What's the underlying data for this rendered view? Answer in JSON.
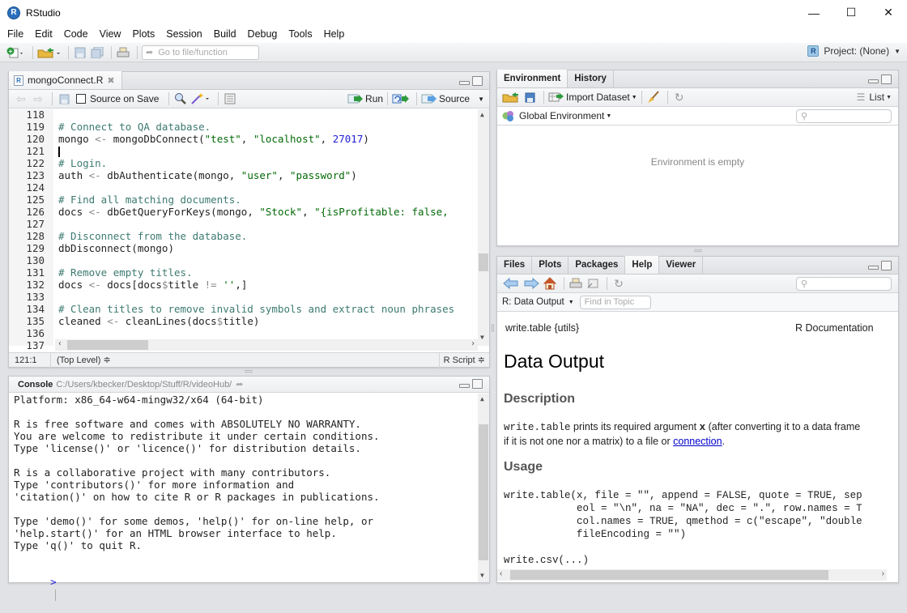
{
  "app": {
    "title": "RStudio",
    "logo_letter": "R",
    "window_controls": {
      "minimize": "—",
      "maximize": "☐",
      "close": "✕"
    }
  },
  "menu": [
    "File",
    "Edit",
    "Code",
    "View",
    "Plots",
    "Session",
    "Build",
    "Debug",
    "Tools",
    "Help"
  ],
  "toolbar": {
    "goto_placeholder": "Go to file/function",
    "project_label": "Project: (None)"
  },
  "editor": {
    "tab_label": "mongoConnect.R",
    "source_on_save_label": "Source on Save",
    "source_on_save_checked": false,
    "run_label": "Run",
    "source_label": "Source",
    "lines": [
      {
        "n": "118",
        "parts": []
      },
      {
        "n": "119",
        "parts": [
          {
            "t": "cmt",
            "v": "# Connect to QA database."
          }
        ]
      },
      {
        "n": "120",
        "parts": [
          {
            "t": "",
            "v": "mongo "
          },
          {
            "t": "op",
            "v": "<-"
          },
          {
            "t": "",
            "v": " mongoDbConnect("
          },
          {
            "t": "str",
            "v": "\"test\""
          },
          {
            "t": "",
            "v": ", "
          },
          {
            "t": "str",
            "v": "\"localhost\""
          },
          {
            "t": "",
            "v": ", "
          },
          {
            "t": "num",
            "v": "27017"
          },
          {
            "t": "",
            "v": ")"
          }
        ]
      },
      {
        "n": "121",
        "parts": [],
        "cursor": true
      },
      {
        "n": "122",
        "parts": [
          {
            "t": "cmt",
            "v": "# Login."
          }
        ]
      },
      {
        "n": "123",
        "parts": [
          {
            "t": "",
            "v": "auth "
          },
          {
            "t": "op",
            "v": "<-"
          },
          {
            "t": "",
            "v": " dbAuthenticate(mongo, "
          },
          {
            "t": "str",
            "v": "\"user\""
          },
          {
            "t": "",
            "v": ", "
          },
          {
            "t": "str",
            "v": "\"password\""
          },
          {
            "t": "",
            "v": ")"
          }
        ]
      },
      {
        "n": "124",
        "parts": []
      },
      {
        "n": "125",
        "parts": [
          {
            "t": "cmt",
            "v": "# Find all matching documents."
          }
        ]
      },
      {
        "n": "126",
        "parts": [
          {
            "t": "",
            "v": "docs "
          },
          {
            "t": "op",
            "v": "<-"
          },
          {
            "t": "",
            "v": " dbGetQueryForKeys(mongo, "
          },
          {
            "t": "str",
            "v": "\"Stock\""
          },
          {
            "t": "",
            "v": ", "
          },
          {
            "t": "str",
            "v": "\"{isProfitable: false,"
          }
        ]
      },
      {
        "n": "127",
        "parts": []
      },
      {
        "n": "128",
        "parts": [
          {
            "t": "cmt",
            "v": "# Disconnect from the database."
          }
        ]
      },
      {
        "n": "129",
        "parts": [
          {
            "t": "",
            "v": "dbDisconnect(mongo)"
          }
        ]
      },
      {
        "n": "130",
        "parts": []
      },
      {
        "n": "131",
        "parts": [
          {
            "t": "cmt",
            "v": "# Remove empty titles."
          }
        ]
      },
      {
        "n": "132",
        "parts": [
          {
            "t": "",
            "v": "docs "
          },
          {
            "t": "op",
            "v": "<-"
          },
          {
            "t": "",
            "v": " docs[docs"
          },
          {
            "t": "op",
            "v": "$"
          },
          {
            "t": "",
            "v": "title "
          },
          {
            "t": "op",
            "v": "!="
          },
          {
            "t": "",
            "v": " "
          },
          {
            "t": "str",
            "v": "''"
          },
          {
            "t": "",
            "v": ",]"
          }
        ]
      },
      {
        "n": "133",
        "parts": []
      },
      {
        "n": "134",
        "parts": [
          {
            "t": "cmt",
            "v": "# Clean titles to remove invalid symbols and extract noun phrases"
          }
        ]
      },
      {
        "n": "135",
        "parts": [
          {
            "t": "",
            "v": "cleaned "
          },
          {
            "t": "op",
            "v": "<-"
          },
          {
            "t": "",
            "v": " cleanLines(docs"
          },
          {
            "t": "op",
            "v": "$"
          },
          {
            "t": "",
            "v": "title)"
          }
        ]
      },
      {
        "n": "136",
        "parts": []
      },
      {
        "n": "137",
        "parts": []
      }
    ],
    "status": {
      "position": "121:1",
      "scope": "(Top Level) ≑",
      "filetype": "R Script ≑"
    }
  },
  "console": {
    "label": "Console",
    "path": "C:/Users/kbecker/Desktop/Stuff/R/videoHub/",
    "lines": [
      "Platform: x86_64-w64-mingw32/x64 (64-bit)",
      "",
      "R is free software and comes with ABSOLUTELY NO WARRANTY.",
      "You are welcome to redistribute it under certain conditions.",
      "Type 'license()' or 'licence()' for distribution details.",
      "",
      "R is a collaborative project with many contributors.",
      "Type 'contributors()' for more information and",
      "'citation()' on how to cite R or R packages in publications.",
      "",
      "Type 'demo()' for some demos, 'help()' for on-line help, or",
      "'help.start()' for an HTML browser interface to help.",
      "Type 'q()' to quit R."
    ],
    "prompt": ">"
  },
  "environment": {
    "tabs": [
      "Environment",
      "History"
    ],
    "active_tab": "Environment",
    "import_label": "Import Dataset",
    "list_label": "List",
    "scope_label": "Global Environment",
    "empty_message": "Environment is empty"
  },
  "help": {
    "tabs": [
      "Files",
      "Plots",
      "Packages",
      "Help",
      "Viewer"
    ],
    "active_tab": "Help",
    "topic_label": "R: Data Output",
    "find_placeholder": "Find in Topic",
    "header_left": "write.table {utils}",
    "header_right": "R Documentation",
    "title": "Data Output",
    "description_heading": "Description",
    "desc_code": "write.table",
    "desc_text1": " prints its required argument ",
    "desc_x": "x",
    "desc_text2": " (after converting it to a data frame",
    "desc_line2": "if it is not one nor a matrix) to a file or ",
    "desc_link": "connection",
    "desc_end": ".",
    "usage_heading": "Usage",
    "usage_lines": [
      "write.table(x, file = \"\", append = FALSE, quote = TRUE, sep",
      "            eol = \"\\n\", na = \"NA\", dec = \".\", row.names = T",
      "            col.names = TRUE, qmethod = c(\"escape\", \"double",
      "            fileEncoding = \"\")",
      "",
      "write.csv(...)"
    ]
  }
}
